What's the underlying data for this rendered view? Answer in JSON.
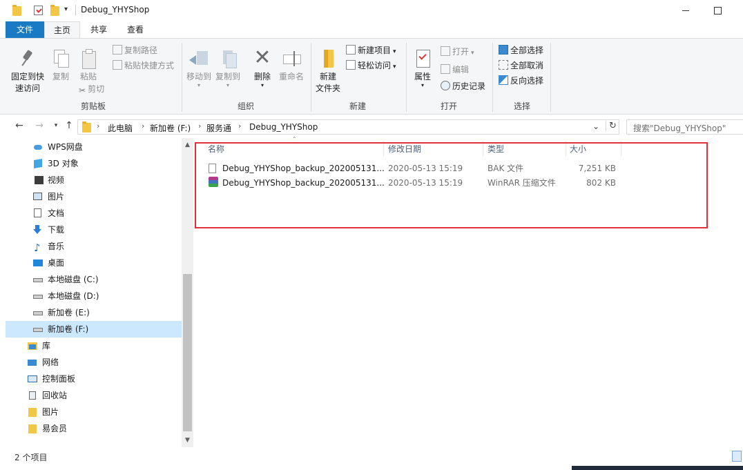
{
  "window": {
    "title": "Debug_YHYShop",
    "minimize": "—",
    "maximize": "☐"
  },
  "tabs": {
    "file": "文件",
    "home": "主页",
    "share": "共享",
    "view": "查看"
  },
  "ribbon": {
    "clipboard": {
      "group": "剪贴板",
      "pin": "固定到快速访问",
      "pin_line1": "固定到快",
      "pin_line2": "速访问",
      "copy": "复制",
      "paste": "粘贴",
      "copy_path": "复制路径",
      "paste_shortcut": "粘贴快捷方式",
      "cut": "剪切"
    },
    "organize": {
      "group": "组织",
      "move_to": "移动到",
      "copy_to": "复制到",
      "delete": "删除",
      "rename": "重命名"
    },
    "new": {
      "group": "新建",
      "new_folder_line1": "新建",
      "new_folder_line2": "文件夹",
      "new_item": "新建项目",
      "easy_access": "轻松访问"
    },
    "open": {
      "group": "打开",
      "properties": "属性",
      "open": "打开",
      "edit": "编辑",
      "history": "历史记录"
    },
    "select": {
      "group": "选择",
      "select_all": "全部选择",
      "select_none": "全部取消",
      "invert": "反向选择"
    }
  },
  "address": {
    "crumbs": [
      "此电脑",
      "新加卷 (F:)",
      "服务通",
      "Debug_YHYShop"
    ],
    "search_placeholder": "搜索\"Debug_YHYShop\""
  },
  "nav": [
    {
      "label": "WPS网盘",
      "icon": "cloud-icon"
    },
    {
      "label": "3D 对象",
      "icon": "cube-icon"
    },
    {
      "label": "视频",
      "icon": "video-icon"
    },
    {
      "label": "图片",
      "icon": "picture-icon"
    },
    {
      "label": "文档",
      "icon": "document-icon"
    },
    {
      "label": "下载",
      "icon": "download-icon"
    },
    {
      "label": "音乐",
      "icon": "music-icon"
    },
    {
      "label": "桌面",
      "icon": "desktop-icon"
    },
    {
      "label": "本地磁盘 (C:)",
      "icon": "drive-icon"
    },
    {
      "label": "本地磁盘 (D:)",
      "icon": "drive-icon"
    },
    {
      "label": "新加卷 (E:)",
      "icon": "drive-icon"
    },
    {
      "label": "新加卷 (F:)",
      "icon": "drive-icon",
      "selected": true
    },
    {
      "label": "库",
      "icon": "library-icon"
    },
    {
      "label": "网络",
      "icon": "network-icon"
    },
    {
      "label": "控制面板",
      "icon": "control-panel-icon"
    },
    {
      "label": "回收站",
      "icon": "recycle-bin-icon"
    },
    {
      "label": "图片",
      "icon": "folder-icon"
    },
    {
      "label": "易会员",
      "icon": "folder-icon"
    }
  ],
  "columns": {
    "name": "名称",
    "modified": "修改日期",
    "type": "类型",
    "size": "大小"
  },
  "files": [
    {
      "name": "Debug_YHYShop_backup_202005131...",
      "modified": "2020-05-13 15:19",
      "type": "BAK 文件",
      "size": "7,251 KB",
      "icon": "file-icon"
    },
    {
      "name": "Debug_YHYShop_backup_202005131...",
      "modified": "2020-05-13 15:19",
      "type": "WinRAR 压缩文件",
      "size": "802 KB",
      "icon": "winrar-icon"
    }
  ],
  "status": {
    "count": "2 个项目"
  },
  "colors": {
    "accent": "#1a7bc4",
    "highlight_box": "#e0303a",
    "nav_selected": "#cce8ff"
  }
}
